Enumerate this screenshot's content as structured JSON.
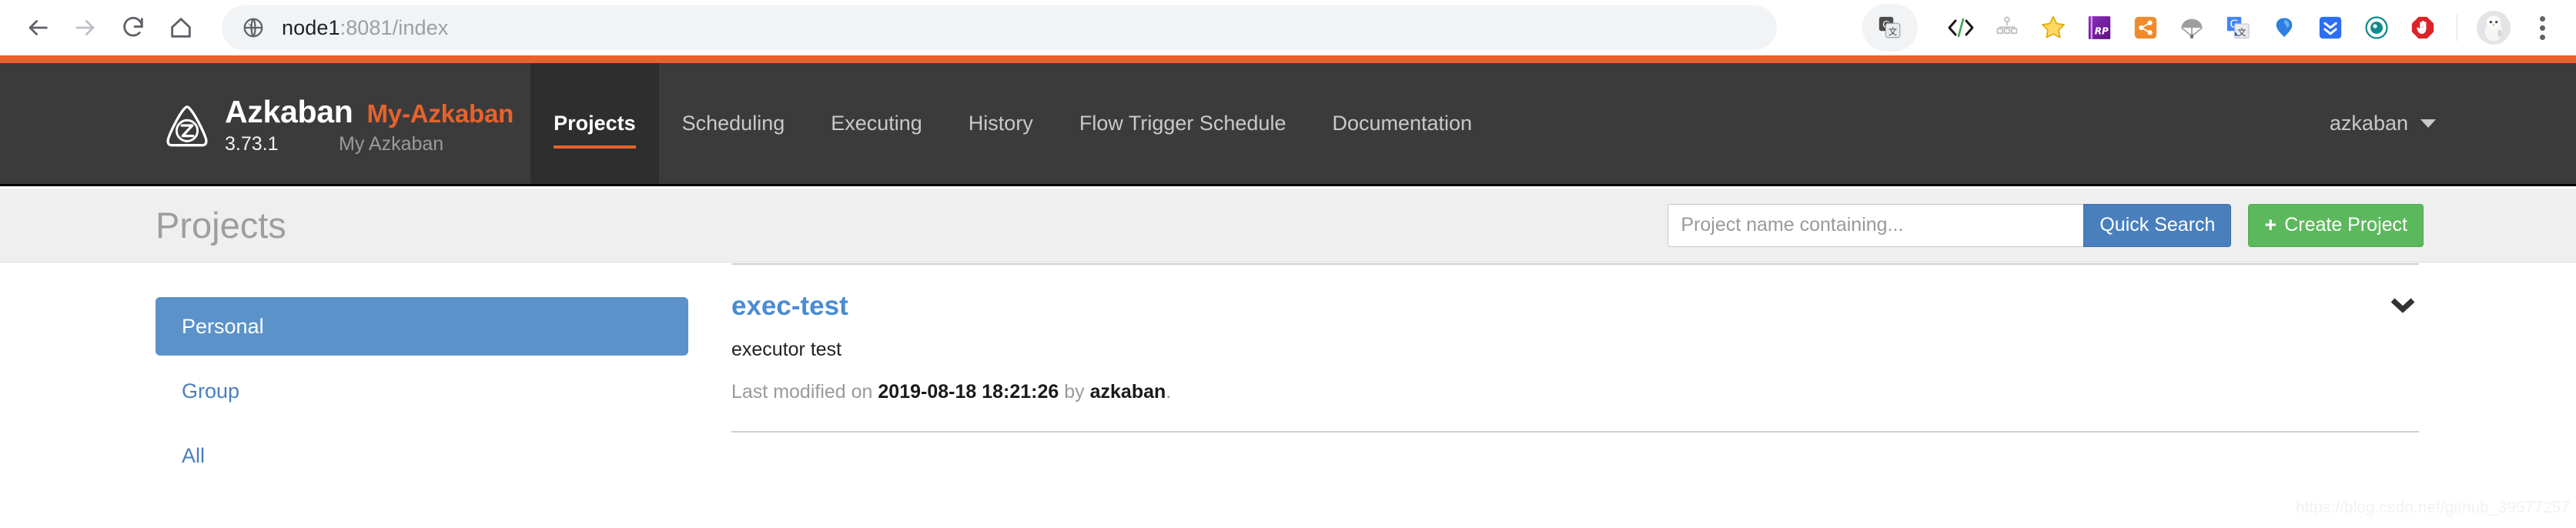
{
  "browser": {
    "nav": {
      "back": "back-arrow",
      "forward": "forward-arrow",
      "reload": "reload-icon",
      "home": "home-icon"
    },
    "url": {
      "host": "node1",
      "path": ":8081/index",
      "full": "node1:8081/index",
      "site_icon": "globe-icon"
    },
    "extensions": [
      "translate-card-icon",
      "code-brackets-icon",
      "sitemap-icon",
      "star-icon",
      "axure-rp-icon",
      "share-nodes-icon",
      "parachute-icon",
      "google-translate-icon",
      "diamond-icon",
      "download-chevrons-icon",
      "eye-teal-icon",
      "adblock-stop-icon"
    ],
    "avatar": "user-avatar",
    "menu": "kebab-menu-icon"
  },
  "navbar": {
    "logo": "azkaban-logo-icon",
    "brand": "Azkaban",
    "brand_alt": "My-Azkaban",
    "version": "3.73.1",
    "subtitle": "My Azkaban",
    "links": [
      {
        "label": "Projects",
        "active": true
      },
      {
        "label": "Scheduling",
        "active": false
      },
      {
        "label": "Executing",
        "active": false
      },
      {
        "label": "History",
        "active": false
      },
      {
        "label": "Flow Trigger Schedule",
        "active": false
      },
      {
        "label": "Documentation",
        "active": false
      }
    ],
    "user": "azkaban",
    "user_caret": "chevron-down-icon"
  },
  "page_header": {
    "title": "Projects",
    "search_placeholder": "Project name containing...",
    "search_value": "",
    "quick_search_label": "Quick Search",
    "create_label": "Create Project",
    "create_plus": "+"
  },
  "sidebar": {
    "items": [
      {
        "label": "Personal",
        "active": true
      },
      {
        "label": "Group",
        "active": false
      },
      {
        "label": "All",
        "active": false
      }
    ]
  },
  "projects": [
    {
      "name": "exec-test",
      "description": "executor test",
      "meta_prefix": "Last modified on ",
      "modified": "2019-08-18 18:21:26",
      "meta_mid": " by ",
      "user": "azkaban",
      "meta_suffix": ".",
      "expand_icon": "chevron-down-icon"
    }
  ],
  "watermark": "https://blog.csdn.net/github_39577257",
  "colors": {
    "accent_orange": "#e8622c",
    "navbar_dark": "#3b3b3b",
    "link_blue": "#4a8bd4",
    "primary_blue": "#4a7fbd",
    "success_green": "#5cb85c",
    "header_band": "#efefef"
  }
}
